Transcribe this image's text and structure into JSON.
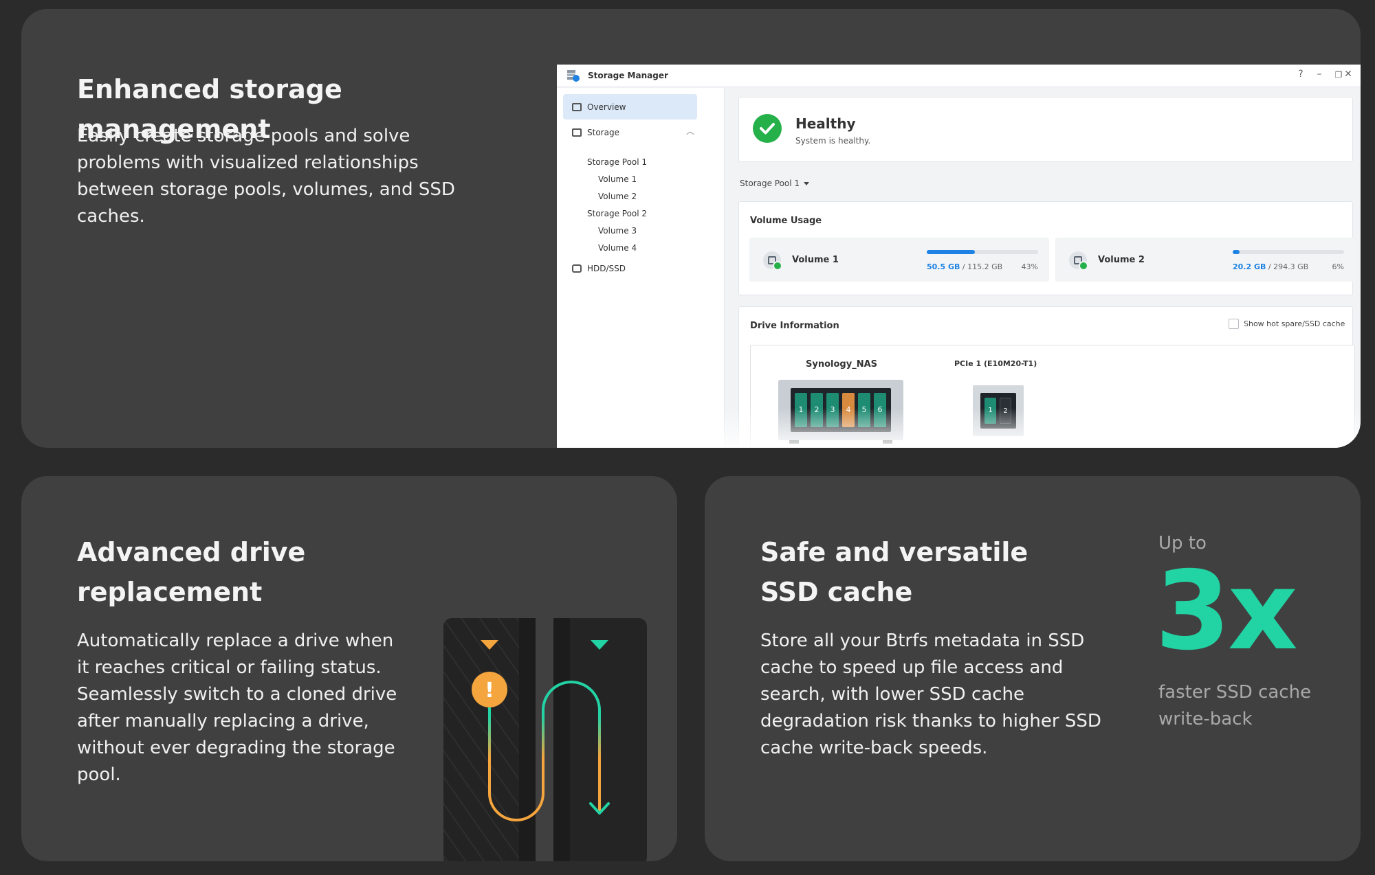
{
  "top_card": {
    "heading": "Enhanced storage management",
    "body": "Easily create storage pools and solve problems with visualized relationships between storage pools, volumes, and SSD caches."
  },
  "storage_manager": {
    "title": "Storage Manager",
    "controls": {
      "help": "?",
      "minimize": "–",
      "restore": "❐",
      "close": "✕"
    },
    "sidebar": {
      "overview": "Overview",
      "storage": "Storage",
      "pools": [
        {
          "label": "Storage Pool 1",
          "volumes": [
            "Volume 1",
            "Volume 2"
          ]
        },
        {
          "label": "Storage Pool 2",
          "volumes": [
            "Volume 3",
            "Volume 4"
          ]
        }
      ],
      "hdd_ssd": "HDD/SSD"
    },
    "status": {
      "title": "Healthy",
      "subtitle": "System is healthy."
    },
    "pool_selector": "Storage Pool 1",
    "volume_usage": {
      "title": "Volume Usage",
      "volumes": [
        {
          "name": "Volume 1",
          "used": "50.5 GB",
          "total": "/ 115.2 GB",
          "percent": "43%",
          "fraction": 0.43
        },
        {
          "name": "Volume 2",
          "used": "20.2 GB",
          "total": "/ 294.3 GB",
          "percent": "6%",
          "fraction": 0.06
        }
      ]
    },
    "drive_info": {
      "title": "Drive Information",
      "checkbox_label": "Show hot spare/SSD cache",
      "nas_name": "Synology_NAS",
      "nas_bays": [
        "1",
        "2",
        "3",
        "4",
        "5",
        "6"
      ],
      "warning_bay": "4",
      "pcie_name": "PCIe 1 (E10M20-T1)",
      "pcie_slots": [
        "1",
        "2"
      ]
    },
    "colors": {
      "accent": "#1d82e3",
      "healthy": "#25b04a",
      "bay": "#1e8c73",
      "bay_warning": "#d88a3e"
    }
  },
  "bottom_left": {
    "heading": "Advanced drive replacement",
    "body": "Automatically replace a drive when it reaches critical or failing status. Seamlessly switch to a cloned drive after manually replacing a drive, without ever degrading the storage pool.",
    "illustration": {
      "warning_symbol": "!",
      "colors": {
        "warning": "#f5a53d",
        "clone": "#22d3a4"
      }
    }
  },
  "bottom_right": {
    "heading": "Safe and versatile SSD cache",
    "body": "Store all your Btrfs metadata in SSD cache to speed up file access and search, with lower SSD cache degradation risk thanks to higher SSD cache write-back speeds.",
    "stat_prefix": "Up to",
    "stat_value": "3x",
    "stat_description": "faster SSD cache write-back",
    "stat_color": "#22d3a4"
  }
}
